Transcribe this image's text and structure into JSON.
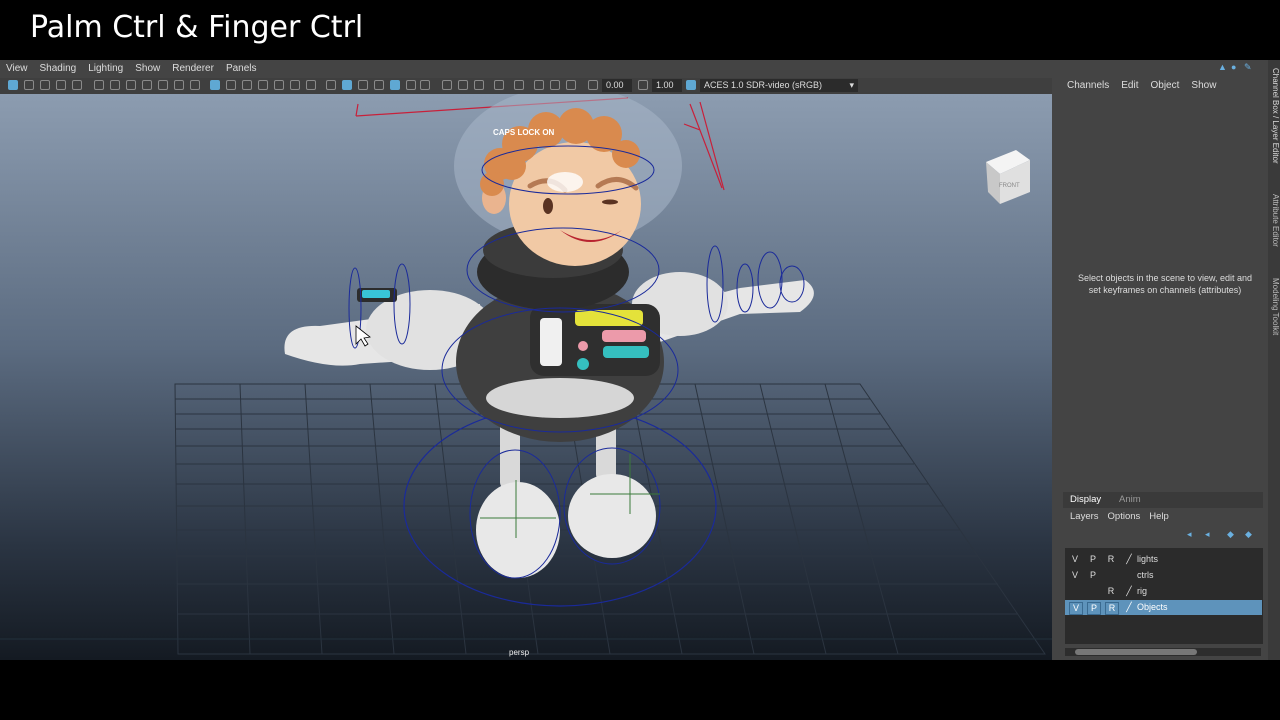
{
  "slide_title": "Palm Ctrl & Finger Ctrl",
  "viewport": {
    "menu": [
      "View",
      "Shading",
      "Lighting",
      "Show",
      "Renderer",
      "Panels"
    ],
    "exposure": "0.00",
    "gamma": "1.00",
    "colorspace": "ACES 1.0 SDR-video (sRGB)",
    "caps_lock": "CAPS LOCK ON",
    "camera": "persp",
    "viewcube": "FRONT"
  },
  "channel_box": {
    "menu": [
      "Channels",
      "Edit",
      "Object",
      "Show"
    ],
    "hint": "Select objects in the scene to view, edit and set keyframes on channels (attributes)"
  },
  "side_tabs": [
    "Channel Box / Layer Editor",
    "Attribute Editor",
    "Modeling Toolkit"
  ],
  "layer_editor": {
    "tabs": [
      "Display",
      "Anim"
    ],
    "menu": [
      "Layers",
      "Options",
      "Help"
    ],
    "layers": [
      {
        "v": "V",
        "p": "P",
        "r": "R",
        "name": "lights",
        "selected": false
      },
      {
        "v": "V",
        "p": "P",
        "r": "",
        "name": "ctrls",
        "selected": false
      },
      {
        "v": "",
        "p": "",
        "r": "R",
        "name": "rig",
        "selected": false
      },
      {
        "v": "V",
        "p": "P",
        "r": "R",
        "name": "Objects",
        "selected": true
      }
    ]
  },
  "colors": {
    "accent": "#5e93bb",
    "panel": "#444444",
    "control_curve": "#1a2a9a",
    "skeleton": "#c8203a",
    "hair": "#d98a4e"
  }
}
